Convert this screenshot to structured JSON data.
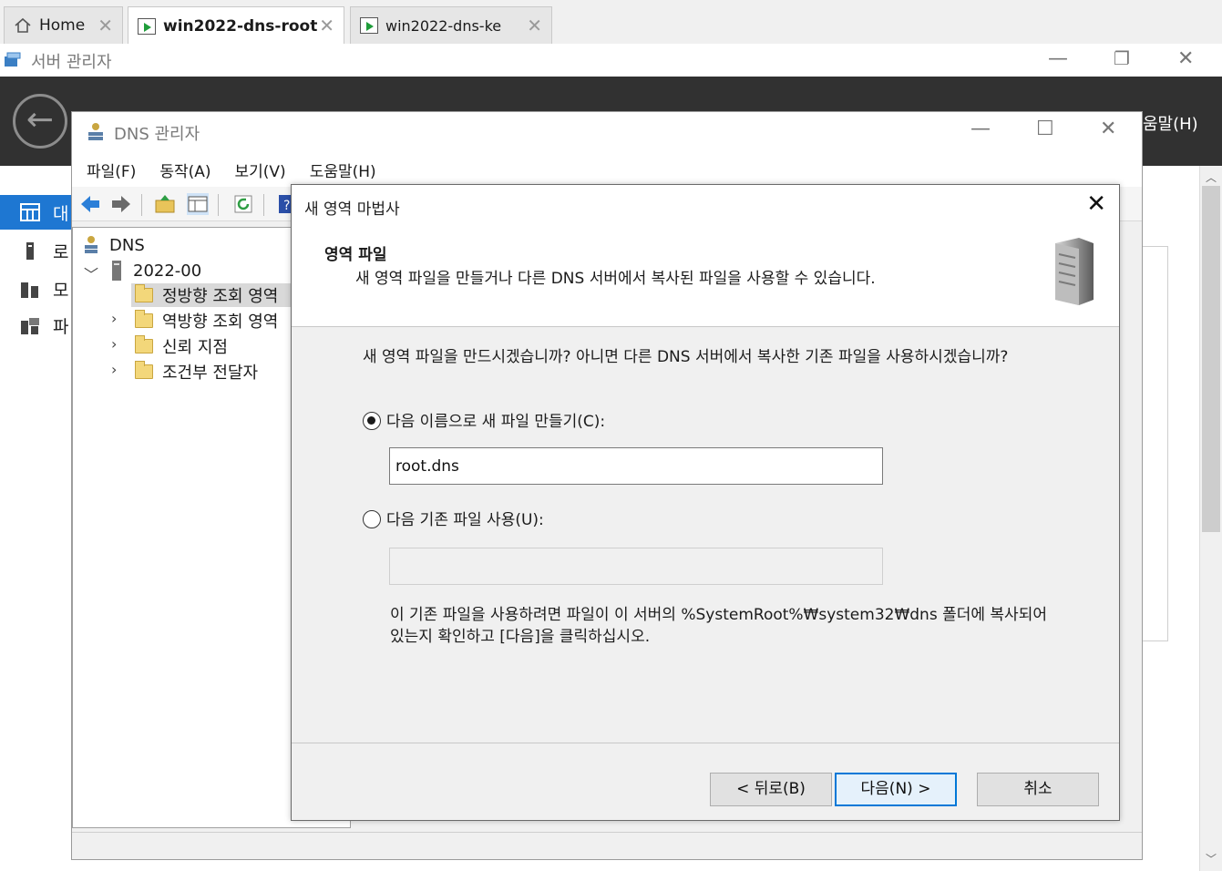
{
  "vm_tabs": [
    {
      "label": "Home"
    },
    {
      "label": "win2022-dns-root"
    },
    {
      "label": "win2022-dns-ke"
    }
  ],
  "server_manager": {
    "title": "서버 관리자",
    "help_menu": "움말(H)",
    "nav_items": [
      {
        "label": "대"
      },
      {
        "label": "로"
      },
      {
        "label": "모"
      },
      {
        "label": "파"
      }
    ]
  },
  "dns_manager": {
    "title": "DNS 관리자",
    "menu": [
      "파일(F)",
      "동작(A)",
      "보기(V)",
      "도움말(H)"
    ],
    "tree": {
      "root": "DNS",
      "server": "2022-00",
      "nodes": [
        "정방향 조회 영역",
        "역방향 조회 영역",
        "신뢰 지점",
        "조건부 전달자"
      ]
    }
  },
  "wizard": {
    "title": "새 영역 마법사",
    "heading": "영역 파일",
    "subheading": "새 영역 파일을 만들거나 다른 DNS 서버에서 복사된 파일을 사용할 수 있습니다.",
    "question": "새 영역 파일을 만드시겠습니까? 아니면 다른 DNS 서버에서 복사한 기존 파일을 사용하시겠습니까?",
    "option_create": "다음 이름으로 새 파일 만들기(C):",
    "create_value": "root.dns",
    "option_existing": "다음 기존 파일 사용(U):",
    "existing_value": "",
    "note": "이 기존 파일을 사용하려면 파일이 이 서버의 %SystemRoot%₩system32₩dns 폴더에 복사되어 있는지 확인하고 [다음]을 클릭하십시오.",
    "back_label": "< 뒤로(B)",
    "next_label": "다음(N) >",
    "cancel_label": "취소"
  }
}
